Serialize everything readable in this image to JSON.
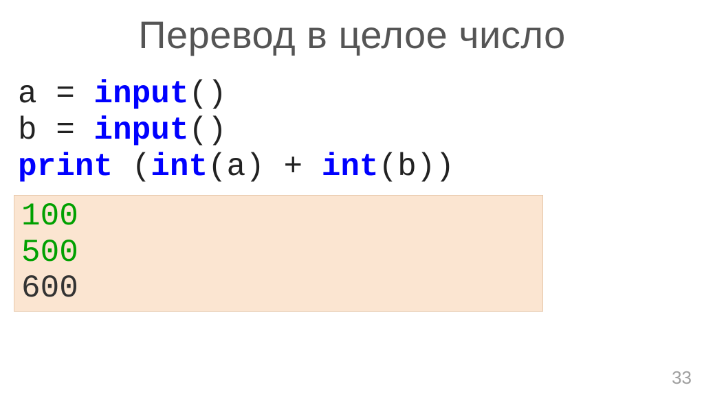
{
  "slide": {
    "title": "Перевод в целое число",
    "page_number": "33"
  },
  "code": {
    "line1": {
      "p1": "a = ",
      "fn": "input",
      "p2": "()"
    },
    "line2": {
      "p1": "b = ",
      "fn": "input",
      "p2": "()"
    },
    "line3": {
      "print": "print",
      "sp": " ",
      "open": "(",
      "int1": "int",
      "arg1": "(a) + ",
      "int2": "int",
      "arg2": "(b))"
    }
  },
  "output": {
    "line1": "100",
    "line2": "500",
    "line3": "600"
  }
}
